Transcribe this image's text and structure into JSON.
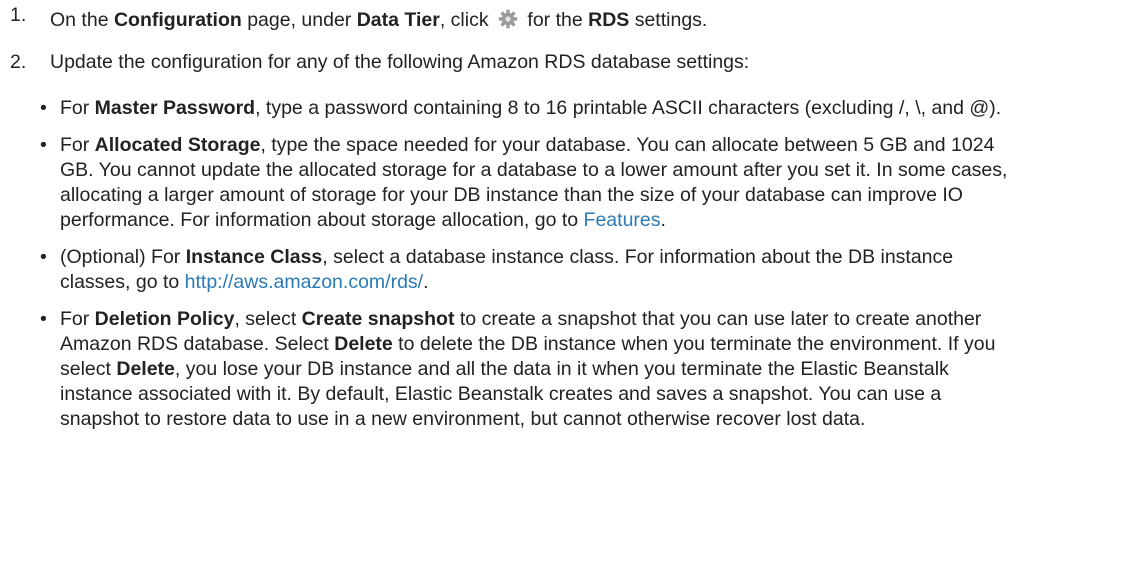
{
  "steps": [
    {
      "num": "1.",
      "t1": "On the ",
      "b1": "Configuration",
      "t2": " page, under ",
      "b2": "Data Tier",
      "t3": ", click ",
      "icon": "gear-icon",
      "t4": " for the ",
      "b3": "RDS",
      "t5": " settings."
    },
    {
      "num": "2.",
      "text": "Update the configuration for any of the following Amazon RDS database settings:"
    }
  ],
  "bullets": [
    {
      "dot": "•",
      "lead": "For ",
      "bold": "Master Password",
      "text": ", type a password containing 8 to 16 printable ASCII characters (excluding /, \\, and @)."
    },
    {
      "dot": "•",
      "lead": "For ",
      "bold": "Allocated Storage",
      "text": ", type the space needed for your database. You can allocate between 5 GB and 1024 GB. You cannot update the allocated storage for a database to a lower amount after you set it. In some cases, allocating a larger amount of storage for your DB instance than the size of your database can improve IO performance. For information about storage allocation, go to ",
      "link": "Features",
      "end": "."
    },
    {
      "dot": "•",
      "lead": "(Optional) For ",
      "bold": "Instance Class",
      "text": ", select a database instance class. For information about the DB instance classes, go to ",
      "link": "http://aws.amazon.com/rds/",
      "end": "."
    },
    {
      "dot": "•",
      "lead": "For ",
      "bold": "Deletion Policy",
      "t1": ", select ",
      "b2": "Create snapshot",
      "t2": " to create a snapshot that you can use later to create another Amazon RDS database. Select ",
      "b3": "Delete",
      "t3": " to delete the DB instance when you terminate the environment. If you select ",
      "b4": "Delete",
      "t4": ", you lose your DB instance and all the data in it when you terminate the Elastic Beanstalk instance associated with it. By default, Elastic Beanstalk creates and saves a snapshot. You can use a snapshot to restore data to use in a new environment, but cannot otherwise recover lost data."
    }
  ],
  "colors": {
    "text": "#222222",
    "link": "#2a7ab8",
    "gear": "#9a9a9a"
  }
}
